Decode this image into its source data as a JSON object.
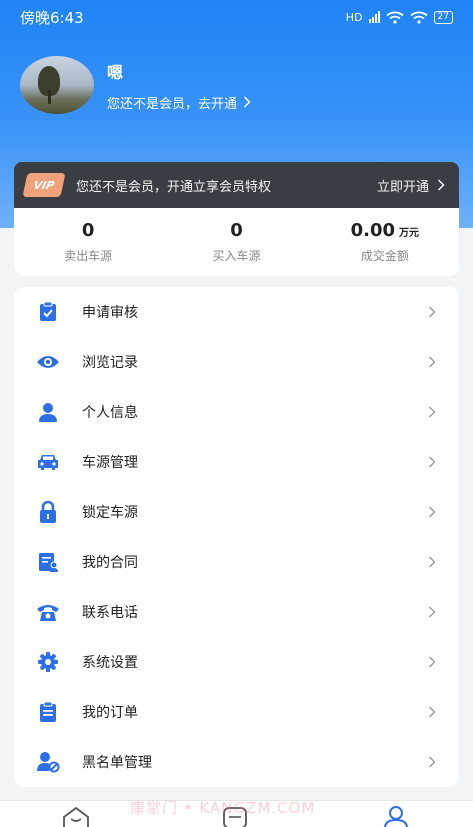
{
  "status_bar": {
    "time": "傍晚6:43",
    "network": "HD",
    "battery": "27"
  },
  "profile": {
    "username": "嗯",
    "member_prompt": "您还不是会员，去开通"
  },
  "vip_banner": {
    "badge": "VIP",
    "text": "您还不是会员，开通立享会员特权",
    "action": "立即开通"
  },
  "stats": [
    {
      "value": "0",
      "unit": "",
      "label": "卖出车源"
    },
    {
      "value": "0",
      "unit": "",
      "label": "买入车源"
    },
    {
      "value": "0.00",
      "unit": "万元",
      "label": "成交金额"
    }
  ],
  "menu": [
    {
      "label": "申请审核",
      "icon": "clipboard-check-icon"
    },
    {
      "label": "浏览记录",
      "icon": "eye-icon"
    },
    {
      "label": "个人信息",
      "icon": "user-icon"
    },
    {
      "label": "车源管理",
      "icon": "car-icon"
    },
    {
      "label": "锁定车源",
      "icon": "lock-icon"
    },
    {
      "label": "我的合同",
      "icon": "contract-icon"
    },
    {
      "label": "联系电话",
      "icon": "phone-icon"
    },
    {
      "label": "系统设置",
      "icon": "gear-icon"
    },
    {
      "label": "我的订单",
      "icon": "order-icon"
    },
    {
      "label": "黑名单管理",
      "icon": "blacklist-icon"
    }
  ],
  "watermark": "康掌门 • KANGZM.COM",
  "colors": {
    "brand_blue": "#1f84f6",
    "icon_blue": "#2c6fe6",
    "vip_bg": "#3a3d44"
  }
}
